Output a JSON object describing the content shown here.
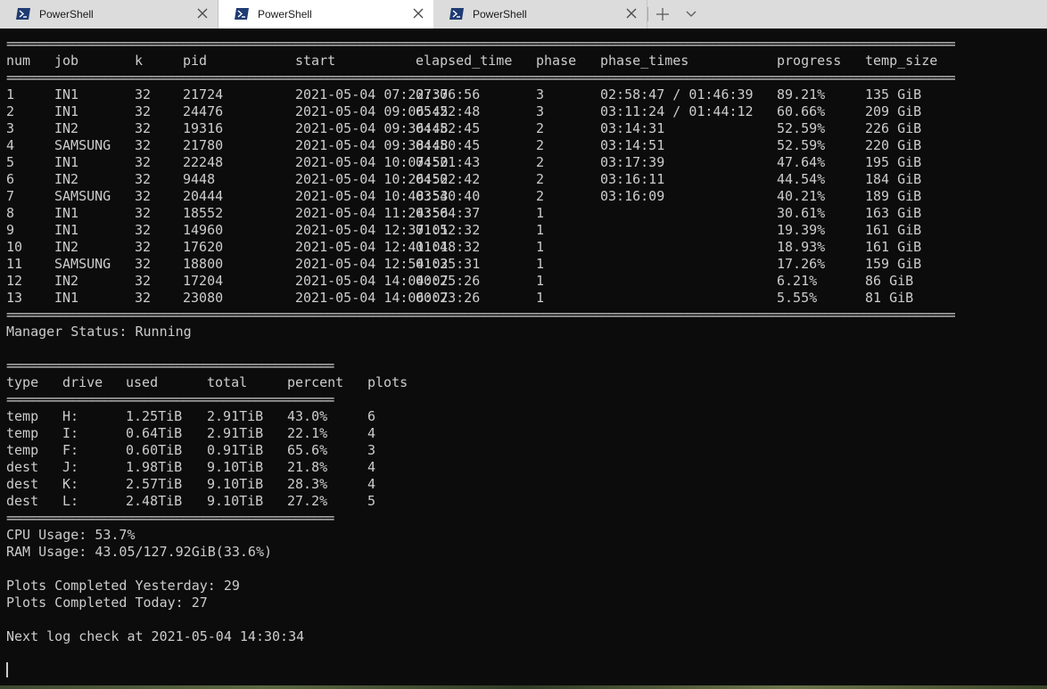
{
  "tabs": [
    {
      "label": "PowerShell",
      "active": false
    },
    {
      "label": "PowerShell",
      "active": true
    },
    {
      "label": "PowerShell",
      "active": false
    }
  ],
  "tab_controls": {
    "new_tab": "+",
    "dropdown": "⌄"
  },
  "jobs_table": {
    "separator": "=================================================================================================================================================",
    "headers": [
      "num",
      "job",
      "k",
      "pid",
      "start",
      "elapsed_time",
      "phase",
      "phase_times",
      "progress",
      "temp_size"
    ],
    "rows": [
      [
        "1",
        "IN1",
        "32",
        "21724",
        "2021-05-04 07:22:37",
        "07:06:56",
        "3",
        "02:58:47 / 01:46:39",
        "89.21%",
        "135 GiB"
      ],
      [
        "2",
        "IN1",
        "32",
        "24476",
        "2021-05-04 09:06:45",
        "05:22:48",
        "3",
        "03:11:24 / 01:44:12",
        "60.66%",
        "209 GiB"
      ],
      [
        "3",
        "IN2",
        "32",
        "19316",
        "2021-05-04 09:36:48",
        "04:52:45",
        "2",
        "03:14:31",
        "52.59%",
        "226 GiB"
      ],
      [
        "4",
        "SAMSUNG",
        "32",
        "21780",
        "2021-05-04 09:38:48",
        "04:50:45",
        "2",
        "03:14:51",
        "52.59%",
        "220 GiB"
      ],
      [
        "5",
        "IN1",
        "32",
        "22248",
        "2021-05-04 10:07:50",
        "04:21:43",
        "2",
        "03:17:39",
        "47.64%",
        "195 GiB"
      ],
      [
        "6",
        "IN2",
        "32",
        "9448",
        "2021-05-04 10:26:52",
        "04:02:42",
        "2",
        "03:16:11",
        "44.54%",
        "184 GiB"
      ],
      [
        "7",
        "SAMSUNG",
        "32",
        "20444",
        "2021-05-04 10:48:53",
        "03:40:40",
        "2",
        "03:16:09",
        "40.21%",
        "189 GiB"
      ],
      [
        "8",
        "IN1",
        "32",
        "18552",
        "2021-05-04 11:24:56",
        "03:04:37",
        "1",
        "",
        "30.61%",
        "163 GiB"
      ],
      [
        "9",
        "IN1",
        "32",
        "14960",
        "2021-05-04 12:37:01",
        "01:52:32",
        "1",
        "",
        "19.39%",
        "161 GiB"
      ],
      [
        "10",
        "IN2",
        "32",
        "17620",
        "2021-05-04 12:41:01",
        "01:48:32",
        "1",
        "",
        "18.93%",
        "161 GiB"
      ],
      [
        "11",
        "SAMSUNG",
        "32",
        "18800",
        "2021-05-04 12:54:02",
        "01:35:31",
        "1",
        "",
        "17.26%",
        "159 GiB"
      ],
      [
        "12",
        "IN2",
        "32",
        "17204",
        "2021-05-04 14:04:07",
        "00:25:26",
        "1",
        "",
        "6.21%",
        "86 GiB"
      ],
      [
        "13",
        "IN1",
        "32",
        "23080",
        "2021-05-04 14:06:07",
        "00:23:26",
        "1",
        "",
        "5.55%",
        "81 GiB"
      ]
    ]
  },
  "manager_status": "Manager Status: Running",
  "drives_table": {
    "separator": "==================================================",
    "headers": [
      "type",
      "drive",
      "used",
      "total",
      "percent",
      "plots"
    ],
    "rows": [
      [
        "temp",
        "H:",
        "1.25TiB",
        "2.91TiB",
        "43.0%",
        "6"
      ],
      [
        "temp",
        "I:",
        "0.64TiB",
        "2.91TiB",
        "22.1%",
        "4"
      ],
      [
        "temp",
        "F:",
        "0.60TiB",
        "0.91TiB",
        "65.6%",
        "3"
      ],
      [
        "dest",
        "J:",
        "1.98TiB",
        "9.10TiB",
        "21.8%",
        "4"
      ],
      [
        "dest",
        "K:",
        "2.57TiB",
        "9.10TiB",
        "28.3%",
        "4"
      ],
      [
        "dest",
        "L:",
        "2.48TiB",
        "9.10TiB",
        "27.2%",
        "5"
      ]
    ]
  },
  "cpu_usage": "CPU Usage: 53.7%",
  "ram_usage": "RAM Usage: 43.05/127.92GiB(33.6%)",
  "plots_yesterday": "Plots Completed Yesterday: 29",
  "plots_today": "Plots Completed Today: 27",
  "next_log_check": "Next log check at 2021-05-04 14:30:34",
  "colors": {
    "terminal_bg": "#0c0c0c",
    "terminal_fg": "#cccccc",
    "tab_bg": "#dcdcdc",
    "tab_active": "#ffffff",
    "ps_icon": "#1f3b73"
  },
  "icons": {
    "tab_icon": "powershell-icon",
    "close": "close-icon",
    "new_tab": "plus-icon",
    "dropdown": "chevron-down-icon"
  }
}
